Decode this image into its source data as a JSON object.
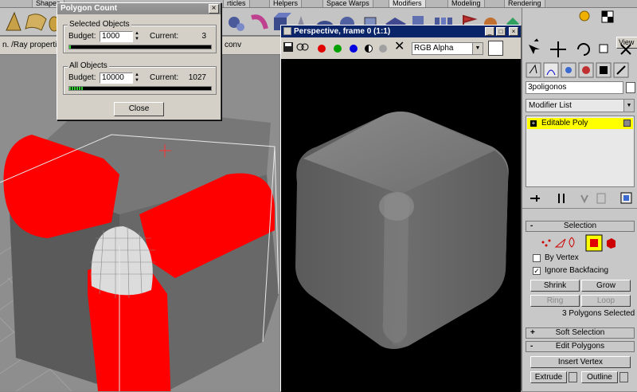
{
  "main_tabs": [
    "Shapes",
    "Helpers",
    "Space Warps",
    "Modifiers",
    "Modeling",
    "Rendering"
  ],
  "particles_tab": "rticles",
  "status_text": "n. /Ray propertie",
  "status_text_right": "conv",
  "view_label": "View",
  "poly_dialog": {
    "title": "Polygon Count",
    "close_glyph": "×",
    "selected": {
      "label": "Selected Objects",
      "budget_label": "Budget:",
      "budget": "1000",
      "current_label": "Current:",
      "current": "3",
      "progress": 0.01
    },
    "all": {
      "label": "All Objects",
      "budget_label": "Budget:",
      "budget": "10000",
      "current_label": "Current:",
      "current": "1027",
      "progress": 0.103
    },
    "close_label": "Close"
  },
  "render_window": {
    "title": "Perspective, frame 0 (1:1)",
    "channel_options": [
      "RGB Alpha"
    ],
    "channel": "RGB Alpha",
    "channel_dots": [
      "#e00000",
      "#00a000",
      "#0000e0"
    ]
  },
  "command_panel": {
    "object_name": "3poligonos",
    "modifier_list": "Modifier List",
    "stack": [
      {
        "label": "Editable Poly"
      }
    ],
    "selection_rollout": "Selection",
    "by_vertex": {
      "label": "By Vertex",
      "checked": false
    },
    "ignore_backfacing": {
      "label": "Ignore Backfacing",
      "checked": true
    },
    "shrink": "Shrink",
    "grow": "Grow",
    "ring": "Ring",
    "loop": "Loop",
    "selection_status": "3 Polygons Selected",
    "soft_selection": "Soft Selection",
    "edit_polygons": "Edit Polygons",
    "insert_vertex": "Insert Vertex",
    "extrude": "Extrude",
    "outline": "Outline",
    "plus_sign": "+",
    "minus_sign": "-"
  },
  "colors": {
    "selection_red": "#ff0000",
    "stack_highlight": "#ffff00",
    "render_title_bg": "#0a246a"
  }
}
